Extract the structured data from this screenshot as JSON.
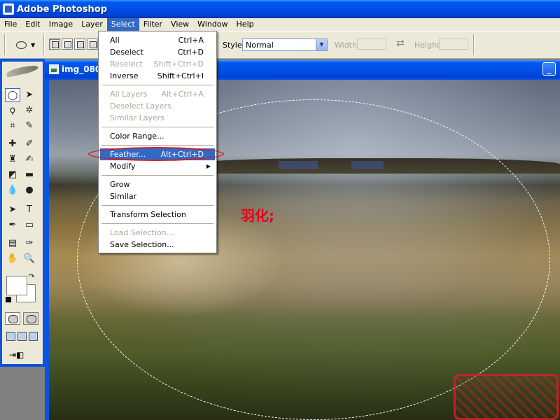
{
  "app": {
    "title": "Adobe Photoshop",
    "icon": "photoshop-app-icon"
  },
  "menubar": [
    "File",
    "Edit",
    "Image",
    "Layer",
    "Select",
    "Filter",
    "View",
    "Window",
    "Help"
  ],
  "options_bar": {
    "style_label": "Style:",
    "style_value": "Normal",
    "width_label": "Width:",
    "height_label": "Height:"
  },
  "document": {
    "title": "img_080"
  },
  "select_menu": {
    "all": {
      "label": "All",
      "shortcut": "Ctrl+A"
    },
    "deselect": {
      "label": "Deselect",
      "shortcut": "Ctrl+D"
    },
    "reselect": {
      "label": "Reselect",
      "shortcut": "Shift+Ctrl+D"
    },
    "inverse": {
      "label": "Inverse",
      "shortcut": "Shift+Ctrl+I"
    },
    "all_layers": {
      "label": "All Layers",
      "shortcut": "Alt+Ctrl+A"
    },
    "deselect_layers": {
      "label": "Deselect Layers"
    },
    "similar_layers": {
      "label": "Similar Layers"
    },
    "color_range": {
      "label": "Color Range..."
    },
    "feather": {
      "label": "Feather...",
      "shortcut": "Alt+Ctrl+D"
    },
    "modify": {
      "label": "Modify"
    },
    "grow": {
      "label": "Grow"
    },
    "similar": {
      "label": "Similar"
    },
    "transform_selection": {
      "label": "Transform Selection"
    },
    "load_selection": {
      "label": "Load Selection..."
    },
    "save_selection": {
      "label": "Save Selection..."
    }
  },
  "annotation": {
    "text": "羽化;",
    "color": "#e3001b"
  },
  "colors": {
    "xp_blue": "#0150e6",
    "menu_highlight": "#316ac5",
    "annotation_red": "#d21f2b"
  }
}
